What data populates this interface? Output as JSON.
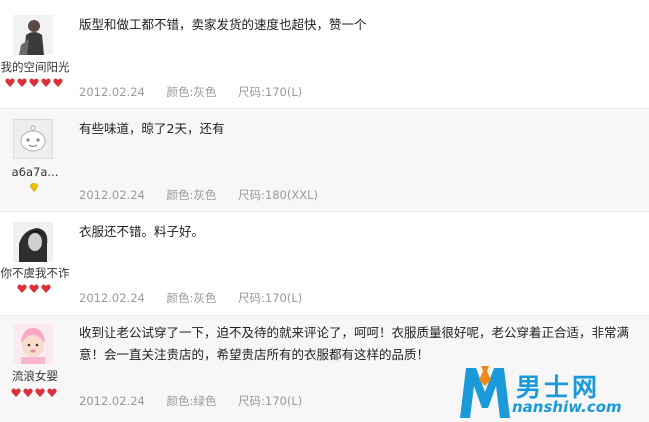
{
  "reviews": [
    {
      "username": "我的空间阳光",
      "text": "版型和做工都不错，卖家发货的速度也超快，赞一个",
      "date": "2012.02.24",
      "color_label": "颜色:",
      "color": "灰色",
      "size_label": "尺码:",
      "size": "170(L)",
      "badge_count": 5,
      "badge_type": "red-heart"
    },
    {
      "username": "a6a7a...",
      "text": "有些味道，晾了2天，还有",
      "date": "2012.02.24",
      "color_label": "颜色:",
      "color": "灰色",
      "size_label": "尺码:",
      "size": "180(XXL)",
      "badge_count": 1,
      "badge_type": "yellow-diamond"
    },
    {
      "username": "你不虞我不诈",
      "text": "衣服还不错。料子好。",
      "date": "2012.02.24",
      "color_label": "颜色:",
      "color": "灰色",
      "size_label": "尺码:",
      "size": "170(L)",
      "badge_count": 3,
      "badge_type": "red-heart"
    },
    {
      "username": "流浪女婴",
      "text": "收到让老公试穿了一下，迫不及待的就来评论了，呵呵！衣服质量很好呢，老公穿着正合适，非常满意！会一直关注贵店的，希望贵店所有的衣服都有这样的品质！",
      "date": "2012.02.24",
      "color_label": "颜色:",
      "color": "绿色",
      "size_label": "尺码:",
      "size": "170(L)",
      "badge_count": 4,
      "badge_type": "red-heart"
    }
  ],
  "watermark": {
    "letter": "M",
    "name": "男士网",
    "domain": "nanshiw.com"
  },
  "colors": {
    "red_heart": "#d9303a",
    "yellow_diamond": "#f2c200",
    "meta_text": "#9a9a9a",
    "brand_blue": "#1a9ad9",
    "brand_orange": "#f08a1c"
  }
}
